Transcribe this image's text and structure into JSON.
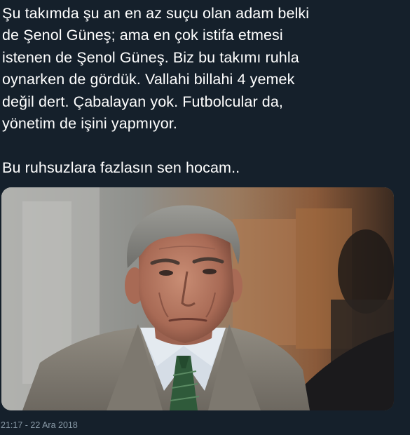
{
  "tweet": {
    "lines": [
      "Şu takımda şu an en az suçu olan adam belki",
      "de Şenol Güneş; ama en çok istifa etmesi",
      "istenen de Şenol Güneş. Biz bu takımı ruhla",
      "oynarken de gördük. Vallahi billahi 4 yemek",
      "değil dert. Çabalayan yok. Futbolcular da,",
      "yönetim de işini yapmıyor."
    ],
    "closing_line": "Bu ruhsuzlara fazlasın sen hocam..",
    "timestamp": "21:17 - 22 Ara 2018"
  },
  "colors": {
    "background": "#15202b",
    "text": "#ffffff",
    "meta": "#8899a6"
  }
}
